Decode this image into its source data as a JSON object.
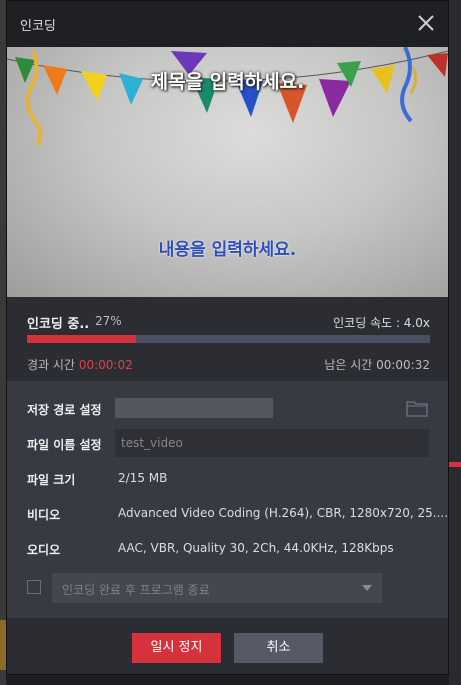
{
  "dialog": {
    "title": "인코딩"
  },
  "preview": {
    "title_text": "제목을 입력하세요.",
    "content_text": "내용을 입력하세요."
  },
  "progress": {
    "status": "인코딩 중..",
    "percent": "27%",
    "speed": "인코딩 속도 : 4.0x",
    "elapsed_label": "경과 시간",
    "elapsed_value": "00:00:02",
    "remaining": "남은 시간 00:00:32",
    "fraction": 0.27
  },
  "settings": {
    "save_path_label": "저장 경로 설정",
    "file_name_label": "파일 이름 설정",
    "file_name_value": "test_video",
    "file_size_label": "파일 크기",
    "file_size_value": "2/15 MB",
    "video_label": "비디오",
    "video_value": "Advanced Video Coding (H.264), CBR, 1280x720, 25....",
    "audio_label": "오디오",
    "audio_value": "AAC, VBR, Quality 30, 2Ch, 44.0KHz, 128Kbps",
    "exit_option": "인코딩 완료 후 프로그램 종료"
  },
  "buttons": {
    "pause": "일시 정지",
    "cancel": "취소"
  },
  "colors": {
    "accent": "#d6323e",
    "panel": "#2b2d33",
    "settings_bg": "#373a42"
  }
}
